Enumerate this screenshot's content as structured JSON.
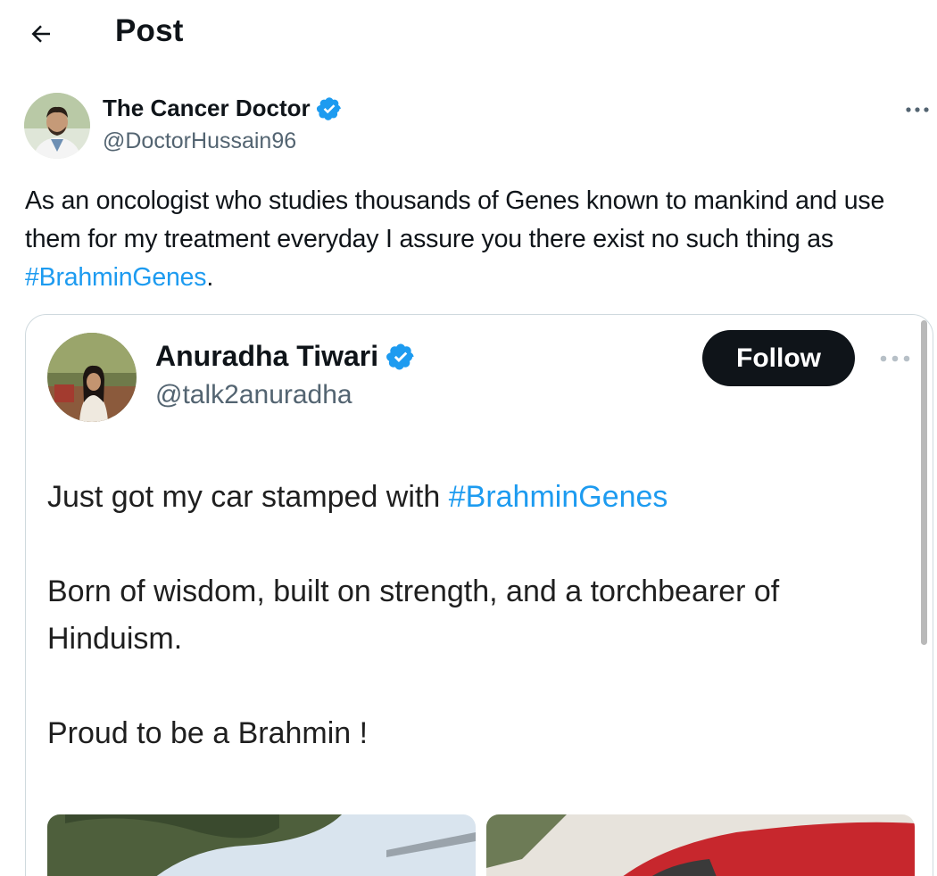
{
  "header": {
    "title": "Post",
    "back_icon": "arrow-left-icon"
  },
  "tweet": {
    "author_name": "The Cancer Doctor",
    "author_handle": "@DoctorHussain96",
    "verified_icon": "verified-badge-icon",
    "more_icon": "more-options-icon",
    "text_before_hashtag": "As an oncologist who studies thousands of Genes known to mankind and use them for my treatment everyday I assure you there exist no such thing as ",
    "hashtag": "#BrahminGenes",
    "text_after_hashtag": "."
  },
  "quote": {
    "author_name": "Anuradha Tiwari",
    "author_handle": "@talk2anuradha",
    "follow_label": "Follow",
    "more_icon": "more-options-icon",
    "line1_prefix": "Just got my car stamped with ",
    "line1_hashtag": "#BrahminGenes",
    "para2": "Born of wisdom, built on strength, and a torchbearer of Hinduism.",
    "para3": "Proud to be a Brahmin !"
  },
  "colors": {
    "accent": "#1d9bf0",
    "text": "#0f1419",
    "secondary": "#536471",
    "border": "#cfd9de",
    "follow_bg": "#0f1419"
  }
}
